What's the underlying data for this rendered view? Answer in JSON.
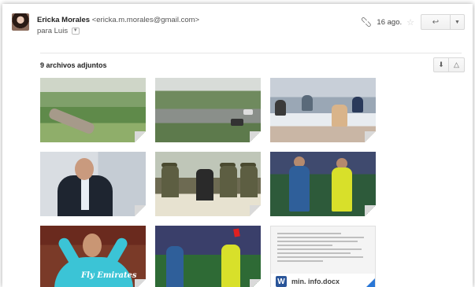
{
  "email": {
    "sender_name": "Ericka Morales",
    "sender_email": "<ericka.m.morales@gmail.com>",
    "to_label": "para Luis",
    "date": "16 ago.",
    "icons": {
      "attachment": "paperclip-icon",
      "star": "star-icon",
      "reply": "reply-icon",
      "more": "chevron-down-icon"
    }
  },
  "attachments": {
    "title": "9 archivos adjuntos",
    "actions": {
      "download": "download-icon",
      "drive": "drive-icon"
    },
    "items": [
      {
        "type": "image",
        "name": "fallen-tree-photo"
      },
      {
        "type": "image",
        "name": "road-debris-photo"
      },
      {
        "type": "image",
        "name": "meeting-photo"
      },
      {
        "type": "image",
        "name": "man-in-suit-photo"
      },
      {
        "type": "image",
        "name": "military-officials-photo"
      },
      {
        "type": "image",
        "name": "soccer-referee-photo"
      },
      {
        "type": "image",
        "name": "soccer-player-photo"
      },
      {
        "type": "image",
        "name": "red-card-photo"
      },
      {
        "type": "document",
        "name": "min. info.docx",
        "app_letter": "W"
      }
    ]
  },
  "overlay_text": {
    "jersey_text": "Fly Emirates"
  }
}
